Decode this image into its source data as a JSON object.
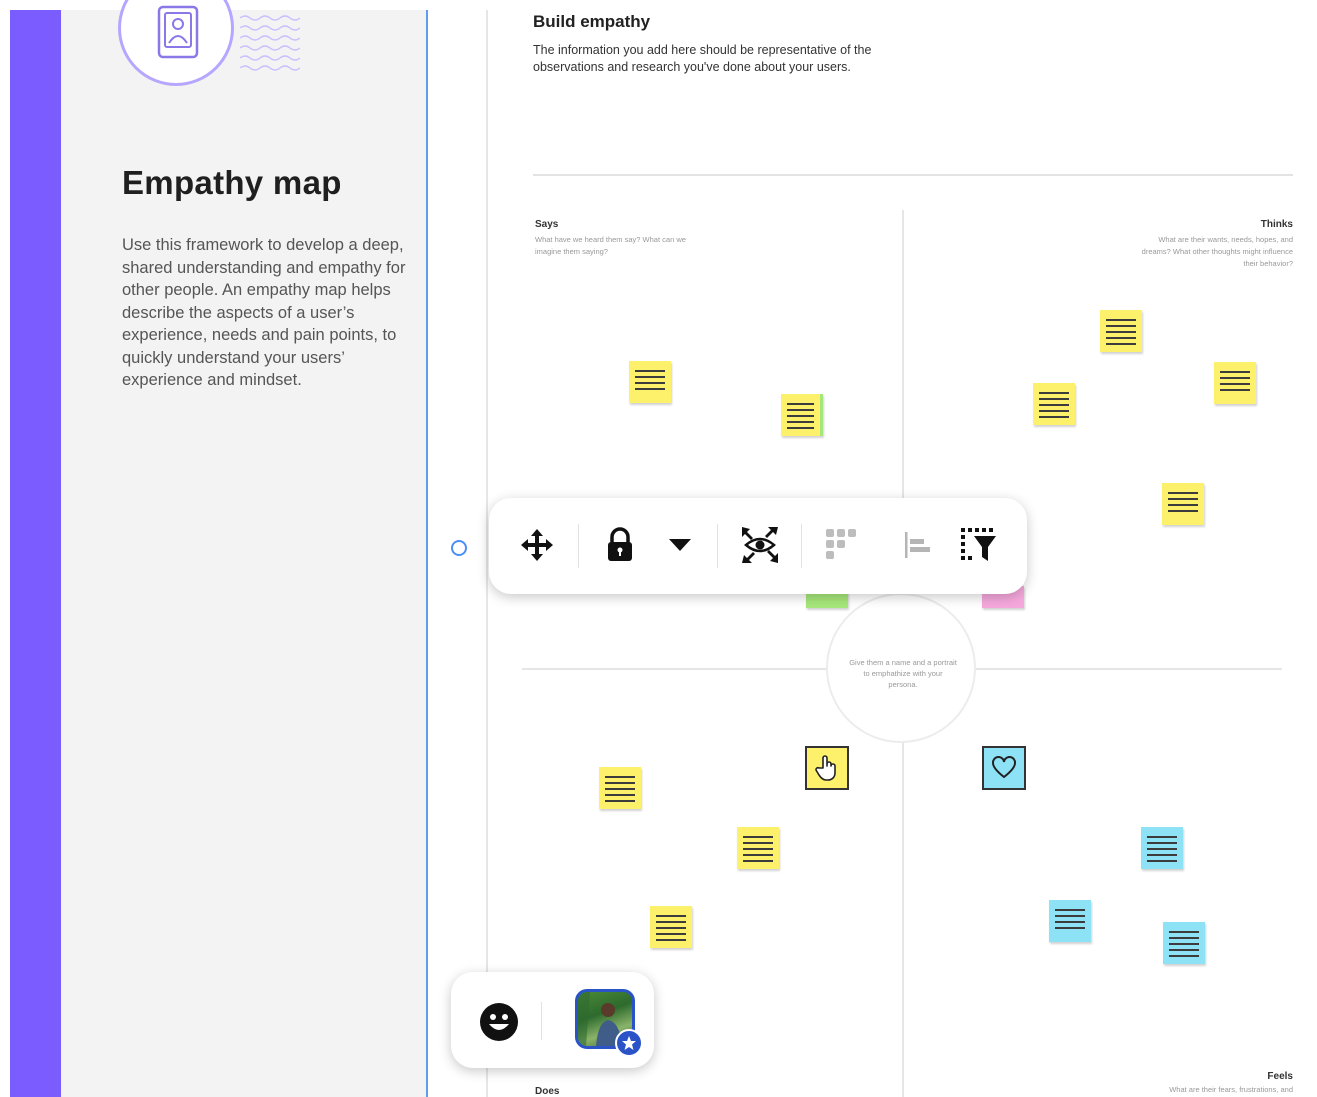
{
  "panel": {
    "title": "Empathy map",
    "description": "Use this framework to develop a deep, shared understanding and empathy for other people. An empathy map helps describe the aspects of a user’s experience, needs and pain points, to quickly understand your users’ experience and mindset."
  },
  "board": {
    "title": "Build empathy",
    "subtitle": "The information you add here should be representative of the observations and research you've done about your users.",
    "quadrants": {
      "says": {
        "title": "Says",
        "description": "What have we heard them say? What can we imagine them saying?"
      },
      "thinks": {
        "title": "Thinks",
        "description": "What are their wants, needs, hopes, and dreams? What other thoughts might influence their behavior?"
      },
      "does": {
        "title": "Does"
      },
      "feels": {
        "title": "Feels",
        "description": "What are their fears, frustrations, and"
      }
    },
    "center_text": "Give them a name and a portrait to emphathize with your persona."
  },
  "toolbar": {
    "buttons": [
      "move-icon",
      "lock-icon",
      "dropdown-arrow-icon",
      "focus-view-icon",
      "grid-dots-icon",
      "align-left-icon",
      "filter-select-icon"
    ]
  },
  "colors": {
    "purple_bar": "#7b5cff",
    "sticky_yellow": "#fdf06a",
    "sticky_blue": "#8ee2f6",
    "sticky_green": "#a6e77a",
    "sticky_pink": "#f5a8dc",
    "selection_blue": "#4d8ff7"
  }
}
